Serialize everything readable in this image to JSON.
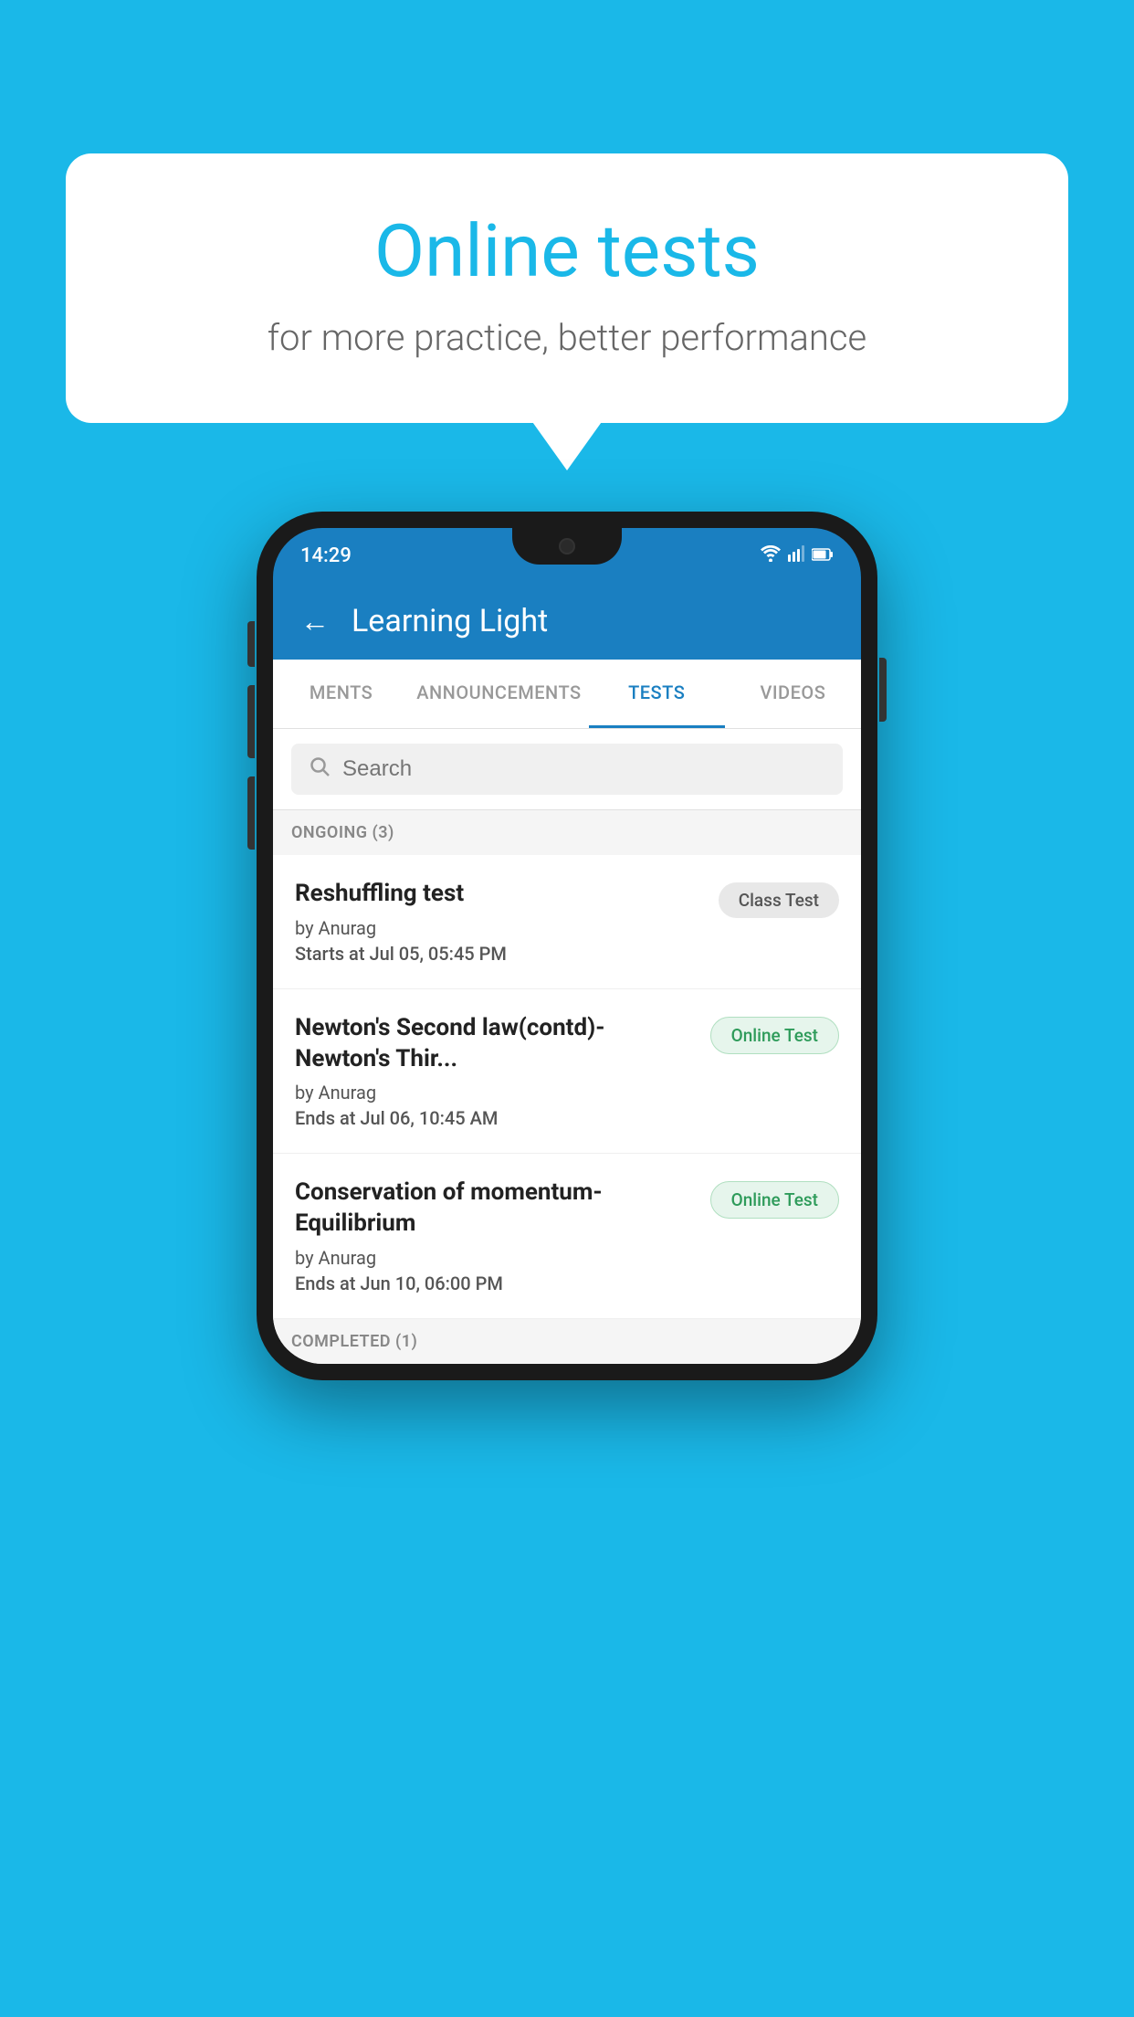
{
  "background_color": "#1ab8e8",
  "speech_bubble": {
    "title": "Online tests",
    "subtitle": "for more practice, better performance"
  },
  "phone": {
    "status_bar": {
      "time": "14:29",
      "wifi": "▼",
      "signal": "▲",
      "battery": "▮"
    },
    "header": {
      "back_label": "←",
      "title": "Learning Light"
    },
    "tabs": [
      {
        "label": "MENTS",
        "active": false
      },
      {
        "label": "ANNOUNCEMENTS",
        "active": false
      },
      {
        "label": "TESTS",
        "active": true
      },
      {
        "label": "VIDEOS",
        "active": false
      }
    ],
    "search": {
      "placeholder": "Search",
      "icon": "🔍"
    },
    "ongoing_section": {
      "label": "ONGOING (3)",
      "items": [
        {
          "name": "Reshuffling test",
          "author": "by Anurag",
          "time_label": "Starts at",
          "time_value": "Jul 05, 05:45 PM",
          "badge": "Class Test",
          "badge_type": "class"
        },
        {
          "name": "Newton's Second law(contd)-Newton's Thir...",
          "author": "by Anurag",
          "time_label": "Ends at",
          "time_value": "Jul 06, 10:45 AM",
          "badge": "Online Test",
          "badge_type": "online"
        },
        {
          "name": "Conservation of momentum-Equilibrium",
          "author": "by Anurag",
          "time_label": "Ends at",
          "time_value": "Jun 10, 06:00 PM",
          "badge": "Online Test",
          "badge_type": "online"
        }
      ]
    },
    "completed_section": {
      "label": "COMPLETED (1)"
    }
  }
}
